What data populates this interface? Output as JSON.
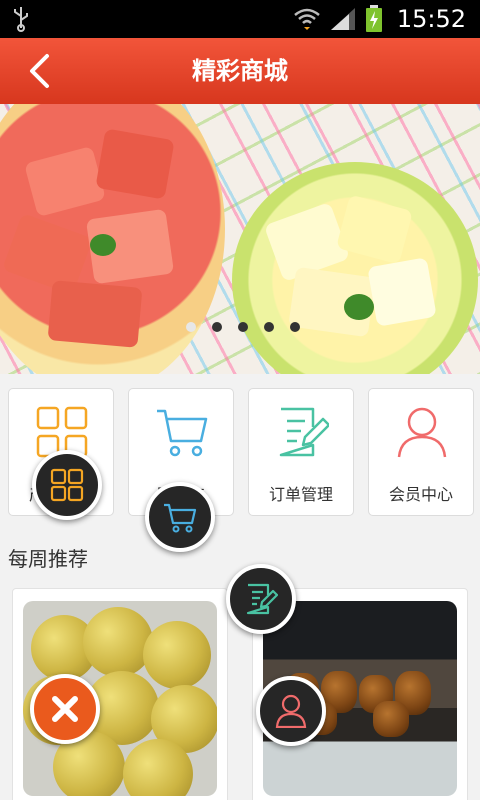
{
  "status_bar": {
    "time": "15:52",
    "icons": [
      "usb-icon",
      "wifi-icon",
      "signal-icon",
      "battery-charging-icon"
    ]
  },
  "header": {
    "title": "精彩商城",
    "back_icon": "chevron-left-icon"
  },
  "banner": {
    "page_count": 5,
    "active_index": 0
  },
  "menu": {
    "items": [
      {
        "label": "产品中心",
        "icon": "grid-icon",
        "color": "#f5a623"
      },
      {
        "label": "购物车",
        "icon": "cart-icon",
        "color": "#49aee0"
      },
      {
        "label": "订单管理",
        "icon": "order-edit-icon",
        "color": "#49c2a2"
      },
      {
        "label": "会员中心",
        "icon": "user-icon",
        "color": "#f06b6b"
      }
    ]
  },
  "section": {
    "title": "每周推荐"
  },
  "products": [
    {
      "image": "sesame-balls"
    },
    {
      "image": "grilled-skewers"
    }
  ],
  "overlay": {
    "buttons": [
      {
        "name": "grid-fab",
        "icon": "grid-icon",
        "accent": "#f5a623"
      },
      {
        "name": "cart-fab",
        "icon": "cart-icon",
        "accent": "#49aee0"
      },
      {
        "name": "order-fab",
        "icon": "order-edit-icon",
        "accent": "#49c2a2"
      },
      {
        "name": "close-fab",
        "icon": "close-icon",
        "accent": "#ea5a1d"
      },
      {
        "name": "user-fab",
        "icon": "user-icon",
        "accent": "#f06b6b"
      }
    ]
  },
  "colors": {
    "header": "#e0432a",
    "background": "#f2f2f2"
  }
}
